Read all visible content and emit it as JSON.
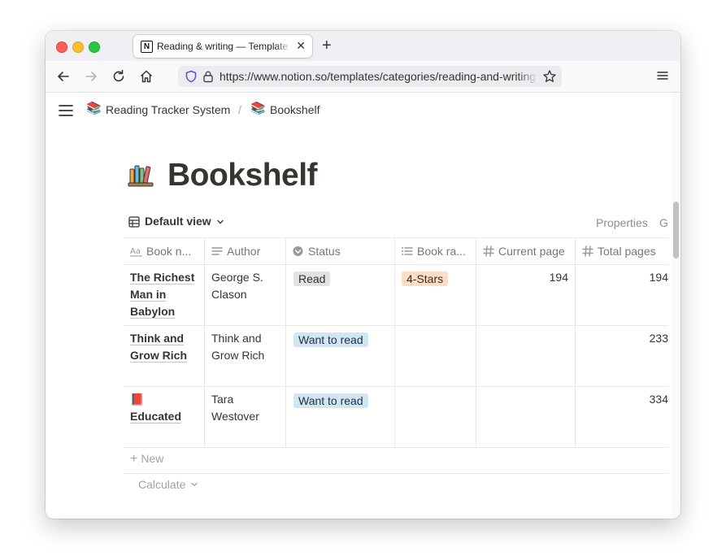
{
  "browser": {
    "tab_title": "Reading & writing — Template Gallery",
    "favicon_letter": "N",
    "url": "https://www.notion.so/templates/categories/reading-and-writing"
  },
  "breadcrumb": {
    "items": [
      {
        "icon": "📚",
        "label": "Reading Tracker System"
      },
      {
        "icon": "📚",
        "label": "Bookshelf"
      }
    ],
    "separator": "/"
  },
  "page": {
    "title": "Bookshelf",
    "view_label": "Default view",
    "properties_label": "Properties",
    "group_label": "G"
  },
  "table": {
    "columns": [
      {
        "label": "Book n...",
        "icon": "text-icon"
      },
      {
        "label": "Author",
        "icon": "lines-icon"
      },
      {
        "label": "Status",
        "icon": "status-icon"
      },
      {
        "label": "Book ra...",
        "icon": "list-icon"
      },
      {
        "label": "Current page",
        "icon": "hash-icon"
      },
      {
        "label": "Total pages",
        "icon": "hash-icon"
      }
    ],
    "rows": [
      {
        "name": "The Richest Man in Babylon",
        "emoji": "",
        "author": "George S. Clason",
        "status": "Read",
        "rating": "4-Stars",
        "current": "194",
        "total": "194"
      },
      {
        "name": "Think and Grow Rich",
        "emoji": "",
        "author": "Think and Grow Rich",
        "status": "Want to read",
        "rating": "",
        "current": "",
        "total": "233"
      },
      {
        "name": "Educated",
        "emoji": "📕",
        "author": "Tara Westover",
        "status": "Want to read",
        "rating": "",
        "current": "",
        "total": "334"
      }
    ],
    "new_label": "New",
    "calculate_label": "Calculate"
  },
  "colors": {
    "status_read_bg": "#e3e2e0",
    "status_want_bg": "#d3e5ef",
    "rating_bg": "#fadec9"
  }
}
